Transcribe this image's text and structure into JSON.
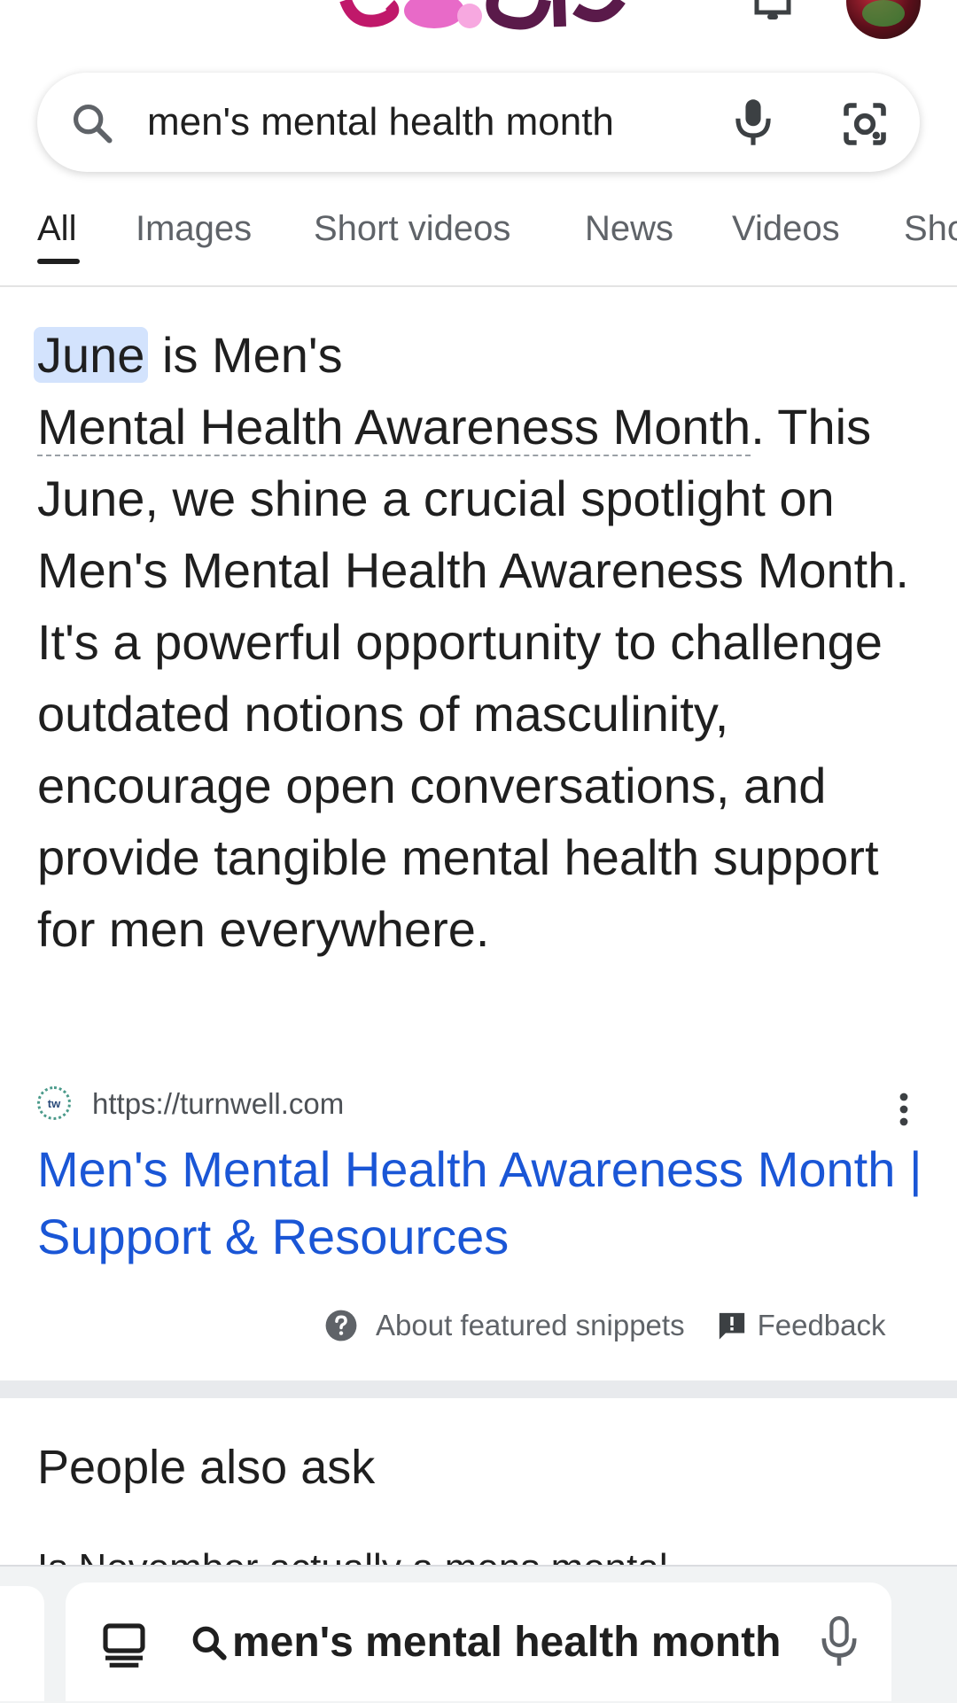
{
  "search": {
    "query": "men's mental health month"
  },
  "tabs": [
    {
      "label": "All",
      "active": true
    },
    {
      "label": "Images"
    },
    {
      "label": "Short videos"
    },
    {
      "label": "News"
    },
    {
      "label": "Videos"
    },
    {
      "label": "Sho"
    }
  ],
  "snippet": {
    "highlight": "June",
    "part1": " is Men's",
    "underlined": "Mental Health Awareness Month",
    "rest": ". This June, we shine a crucial spotlight on Men's Mental Health Awareness Month. It's a powerful opportunity to challenge outdated notions of masculinity, encourage open conversations, and provide tangible mental health support for men everywhere."
  },
  "result": {
    "favicon_text": "tw",
    "url": "https://turnwell.com",
    "title": "Men's Mental Health Awareness Month | Support & Resources"
  },
  "footer": {
    "about": "About featured snippets",
    "feedback": "Feedback"
  },
  "paa": {
    "heading": "People also ask",
    "first_question": "Is November actually a mens mental"
  },
  "bottom_bar": {
    "query": "men's mental health month"
  },
  "colors": {
    "link": "#1a56d6",
    "highlight": "#d3e3fd",
    "muted": "#5f6368"
  }
}
